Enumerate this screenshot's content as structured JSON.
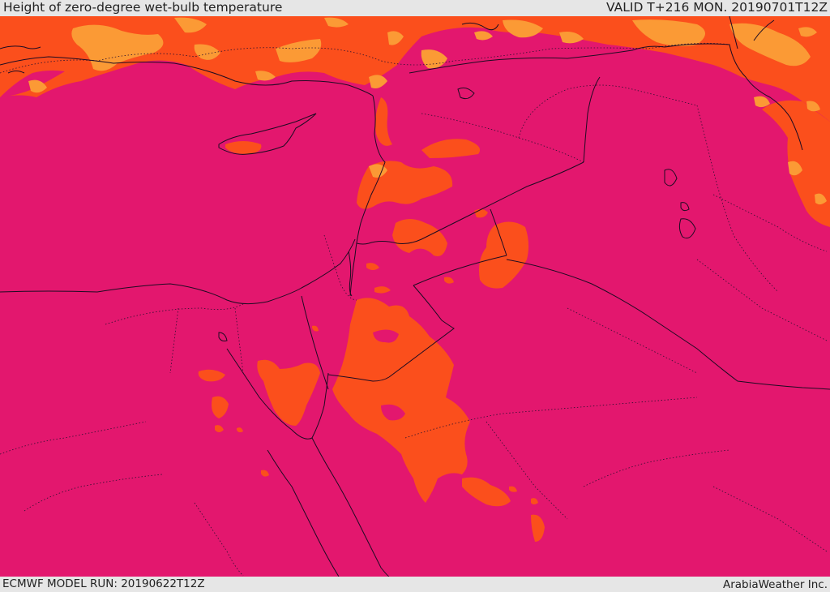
{
  "header": {
    "title": "Height of zero-degree wet-bulb temperature",
    "valid": "VALID T+216 MON. 20190701T12Z"
  },
  "footer": {
    "model_run": "ECMWF MODEL RUN: 20190622T12Z",
    "credit": "ArabiaWeather Inc."
  },
  "colors": {
    "background_level": "#e3176e",
    "mid_level": "#fb4f1c",
    "high_level": "#fb9a35"
  }
}
